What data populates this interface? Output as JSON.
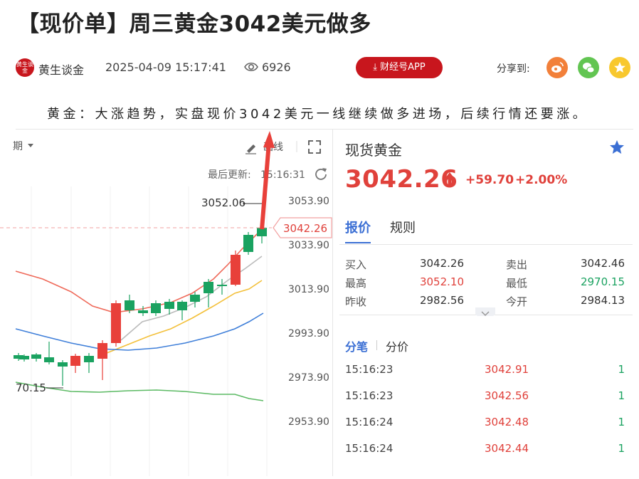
{
  "article": {
    "title": "【现价单】周三黄金3042美元做多",
    "author": "黄生谈金",
    "avatar_text": "黄生谈金",
    "date": "2025-04-09 15:17:41",
    "views": "6926",
    "app_button": "财经号APP",
    "share_label": "分享到:",
    "share_icons": [
      "weibo-icon",
      "wechat-icon",
      "qzone-icon"
    ],
    "summary": "黄金：大涨趋势，实盘现价3042美元一线继续做多进场，后续行情还要涨。"
  },
  "chart": {
    "period_label": "期",
    "draw_label": "画线",
    "last_update_label": "最后更新:",
    "last_update_time": "15:16:31",
    "price_ticks": [
      "3053.90",
      "3033.90",
      "3013.90",
      "2993.90",
      "2973.90",
      "2953.90"
    ],
    "high_marker": "3052.06",
    "low_marker": "70.15",
    "current_price_tag": "3042.26",
    "colors": {
      "up": "#e8403a",
      "down": "#1aa260",
      "ma_red": "#ef6a5a",
      "ma_gray": "#bbbbbb",
      "ma_yellow": "#f3c03a",
      "ma_blue": "#3f7fd9",
      "ma_green": "#5cba64",
      "annotation": "#e8403a"
    }
  },
  "quote": {
    "name": "现货黄金",
    "price": "3042.26",
    "change": "+59.70",
    "change_pct": "+2.00%",
    "tabs": [
      "报价",
      "规则"
    ],
    "rows": [
      {
        "label1": "买入",
        "value1": "3042.26",
        "label2": "卖出",
        "value2": "3042.46"
      },
      {
        "label1": "最高",
        "value1": "3052.10",
        "label2": "最低",
        "value2": "2970.15"
      },
      {
        "label1": "昨收",
        "value1": "2982.56",
        "label2": "今开",
        "value2": "2984.13"
      }
    ],
    "trade_tabs": [
      "分笔",
      "分价"
    ],
    "trades": [
      {
        "time": "15:16:23",
        "price": "3042.91",
        "volume": "1"
      },
      {
        "time": "15:16:23",
        "price": "3042.56",
        "volume": "1"
      },
      {
        "time": "15:16:24",
        "price": "3042.48",
        "volume": "1"
      },
      {
        "time": "15:16:24",
        "price": "3042.44",
        "volume": "1"
      }
    ]
  }
}
